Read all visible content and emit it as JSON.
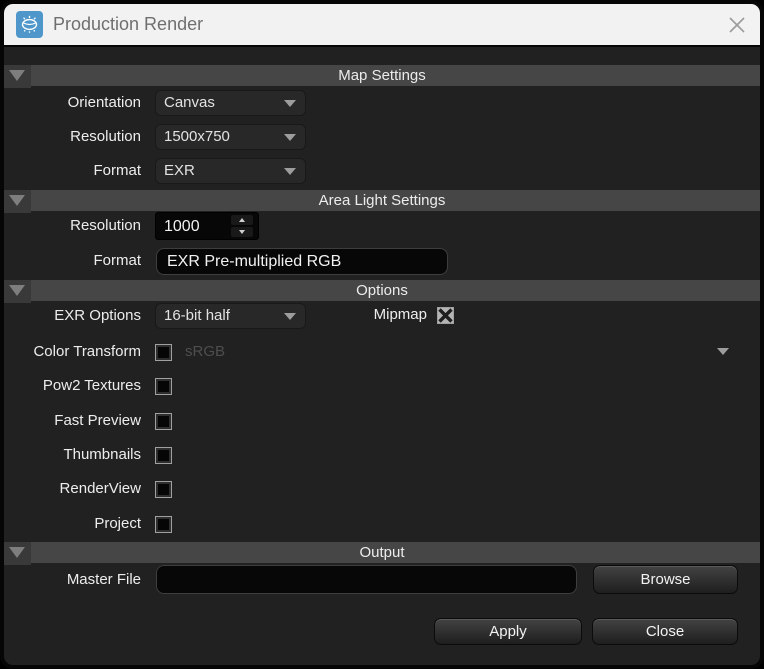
{
  "window": {
    "title": "Production Render"
  },
  "colors": {
    "titlebar_bg": "#f2f2f2",
    "content_bg": "#212121",
    "section_header_bg": "#464646",
    "app_icon_blue": "#4f97cb",
    "field_bg": "#070707"
  },
  "sections": {
    "map_settings": {
      "title": "Map Settings",
      "orientation_label": "Orientation",
      "orientation_value": "Canvas",
      "resolution_label": "Resolution",
      "resolution_value": "1500x750",
      "format_label": "Format",
      "format_value": "EXR"
    },
    "area_light": {
      "title": "Area Light Settings",
      "resolution_label": "Resolution",
      "resolution_value": "1000",
      "format_label": "Format",
      "format_value": "EXR Pre-multiplied RGB"
    },
    "options": {
      "title": "Options",
      "exr_label": "EXR Options",
      "exr_value": "16-bit half",
      "mipmap_label": "Mipmap",
      "mipmap_checked": true,
      "color_transform_label": "Color Transform",
      "color_transform_checked": false,
      "color_transform_value": "sRGB",
      "toggles": [
        {
          "label": "Pow2 Textures",
          "checked": false
        },
        {
          "label": "Fast Preview",
          "checked": false
        },
        {
          "label": "Thumbnails",
          "checked": false
        },
        {
          "label": "RenderView",
          "checked": false
        },
        {
          "label": "Project",
          "checked": false
        }
      ]
    },
    "output": {
      "title": "Output",
      "master_file_label": "Master File",
      "master_file_value": "",
      "browse_label": "Browse"
    }
  },
  "footer": {
    "apply_label": "Apply",
    "close_label": "Close"
  }
}
